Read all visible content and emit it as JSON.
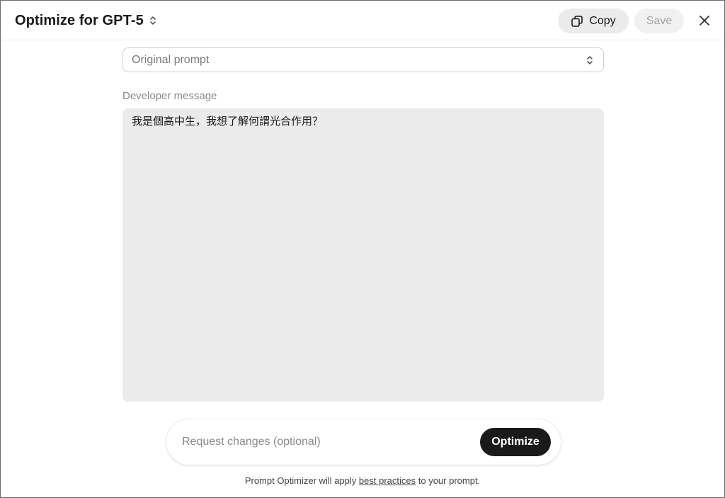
{
  "header": {
    "title": "Optimize for GPT-5",
    "copy_label": "Copy",
    "save_label": "Save"
  },
  "prompt_select": {
    "selected": "Original prompt"
  },
  "developer_message": {
    "label": "Developer message",
    "value": "我是個高中生，我想了解何謂光合作用？"
  },
  "request": {
    "placeholder": "Request changes (optional)",
    "optimize_label": "Optimize"
  },
  "footer": {
    "prefix": "Prompt Optimizer will apply ",
    "link": "best practices",
    "suffix": " to your prompt."
  },
  "icons": {
    "title_chevron": "chevron-up-down-icon",
    "copy": "copy-icon",
    "close": "close-icon",
    "select_chevron": "chevron-up-down-icon"
  },
  "colors": {
    "primary_button": "#1a1a1a",
    "secondary_button": "#ebebeb",
    "textarea_bg": "#ebebeb"
  }
}
